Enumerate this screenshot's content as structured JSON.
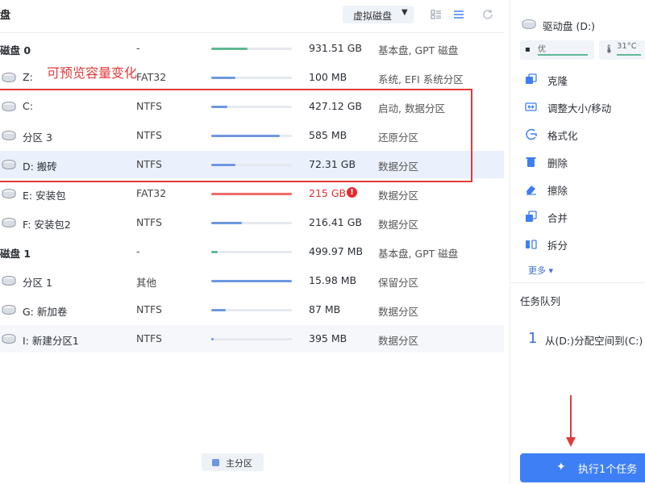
{
  "header": {
    "title": "盘",
    "virtual_disk_label": "虚拟磁盘"
  },
  "annotation": "可预览容量变化",
  "disks": [
    {
      "kind": "group",
      "name": "磁盘 0",
      "fs": "-",
      "fill": 0.45,
      "color": "green",
      "size": "931.51 GB",
      "type": "基本盘, GPT 磁盘"
    },
    {
      "kind": "part",
      "name": "Z:",
      "fs": "FAT32",
      "fill": 0.3,
      "color": "blue",
      "size": "100 MB",
      "type": "系统, EFI 系统分区"
    },
    {
      "kind": "part",
      "name": "C:",
      "fs": "NTFS",
      "fill": 0.2,
      "color": "blue",
      "size": "427.12 GB",
      "type": "启动, 数据分区"
    },
    {
      "kind": "part",
      "name": "分区 3",
      "fs": "NTFS",
      "fill": 0.85,
      "color": "blue",
      "size": "585 MB",
      "type": "还原分区"
    },
    {
      "kind": "part",
      "name": "D: 搬砖",
      "fs": "NTFS",
      "fill": 0.3,
      "color": "blue",
      "size": "72.31 GB",
      "type": "数据分区",
      "selected": true
    },
    {
      "kind": "part",
      "name": "E: 安装包",
      "fs": "FAT32",
      "fill": 1.0,
      "color": "red",
      "size": "215 GB",
      "type": "数据分区",
      "warn": true
    },
    {
      "kind": "part",
      "name": "F: 安装包2",
      "fs": "NTFS",
      "fill": 0.38,
      "color": "blue",
      "size": "216.41 GB",
      "type": "数据分区"
    },
    {
      "kind": "group",
      "name": "磁盘 1",
      "fs": "-",
      "fill": 0.08,
      "color": "green",
      "size": "499.97 MB",
      "type": "基本盘, GPT 磁盘"
    },
    {
      "kind": "part",
      "name": "分区 1",
      "fs": "其他",
      "fill": 1.0,
      "color": "blue",
      "size": "15.98 MB",
      "type": "保留分区"
    },
    {
      "kind": "part",
      "name": "G: 新加卷",
      "fs": "NTFS",
      "fill": 0.18,
      "color": "blue",
      "size": "87 MB",
      "type": "数据分区"
    },
    {
      "kind": "part",
      "name": "I: 新建分区1",
      "fs": "NTFS",
      "fill": 0.03,
      "color": "blue",
      "size": "395 MB",
      "type": "数据分区",
      "lastsel": true
    }
  ],
  "warn_symbol": "!",
  "legend": {
    "label": "主分区"
  },
  "sidebar": {
    "drive_label": "驱动盘 (D:)",
    "health_label": "优",
    "temp_label": "31°C",
    "actions": [
      {
        "key": "clone",
        "label": "克隆",
        "icon": "clone-icon"
      },
      {
        "key": "resize",
        "label": "调整大小/移动",
        "icon": "resize-icon"
      },
      {
        "key": "format",
        "label": "格式化",
        "icon": "format-icon"
      },
      {
        "key": "delete",
        "label": "删除",
        "icon": "trash-icon"
      },
      {
        "key": "wipe",
        "label": "擦除",
        "icon": "eraser-icon"
      },
      {
        "key": "merge",
        "label": "合并",
        "icon": "merge-icon"
      },
      {
        "key": "split",
        "label": "拆分",
        "icon": "split-icon"
      }
    ],
    "more_label": "更多 ▾",
    "queue_title": "任务队列",
    "queue_items": [
      {
        "num": "1",
        "text": "从(D:)分配空间到(C:)"
      }
    ],
    "execute_label": "执行1个任务"
  },
  "colors": {
    "accent": "#3f7ff5",
    "bar_blue": "#6e97df",
    "bar_green": "#5fb894",
    "bar_red": "#ef6b6b",
    "annotation": "#e23b3b"
  }
}
